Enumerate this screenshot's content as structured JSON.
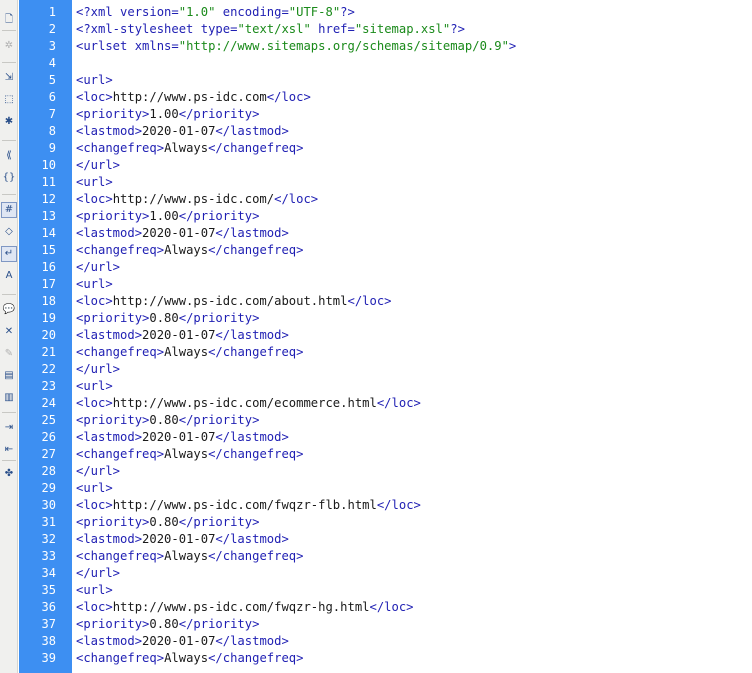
{
  "toolbar": {
    "icons": [
      {
        "name": "open-documents-icon",
        "glyph": "🗋",
        "disabled": false,
        "pressed": false
      },
      {
        "name": "show-code-navigator-icon",
        "glyph": "✲",
        "disabled": true,
        "pressed": false
      },
      {
        "name": "collapse-full-tag-icon",
        "glyph": "⇲",
        "disabled": false,
        "pressed": false
      },
      {
        "name": "collapse-selection-icon",
        "glyph": "⬚",
        "disabled": false,
        "pressed": false
      },
      {
        "name": "expand-all-icon",
        "glyph": "✱",
        "disabled": false,
        "pressed": false
      },
      {
        "name": "select-parent-tag-icon",
        "glyph": "⟪",
        "disabled": false,
        "pressed": false
      },
      {
        "name": "balance-braces-icon",
        "glyph": "{}",
        "disabled": false,
        "pressed": false
      },
      {
        "name": "line-numbers-icon",
        "glyph": "#",
        "disabled": false,
        "pressed": true
      },
      {
        "name": "highlight-invalid-code-icon",
        "glyph": "◇",
        "disabled": false,
        "pressed": false
      },
      {
        "name": "word-wrap-icon",
        "glyph": "↵",
        "disabled": false,
        "pressed": true
      },
      {
        "name": "syntax-coloring-icon",
        "glyph": "A",
        "disabled": false,
        "pressed": false
      },
      {
        "name": "apply-comment-icon",
        "glyph": "💬",
        "disabled": false,
        "pressed": false
      },
      {
        "name": "remove-comment-icon",
        "glyph": "✕",
        "disabled": false,
        "pressed": false
      },
      {
        "name": "wrap-tag-icon",
        "glyph": "✎",
        "disabled": true,
        "pressed": false
      },
      {
        "name": "recent-snippets-icon",
        "glyph": "▤",
        "disabled": false,
        "pressed": false
      },
      {
        "name": "move-css-icon",
        "glyph": "▥",
        "disabled": false,
        "pressed": false
      },
      {
        "name": "indent-code-icon",
        "glyph": "⇥",
        "disabled": false,
        "pressed": false
      },
      {
        "name": "outdent-code-icon",
        "glyph": "⇤",
        "disabled": false,
        "pressed": false
      },
      {
        "name": "format-source-code-icon",
        "glyph": "✤",
        "disabled": false,
        "pressed": false
      }
    ]
  },
  "colors": {
    "gutter": "#3d8ff2",
    "tag": "#1f1fb3",
    "string": "#1a8a1a",
    "text": "#1a1a1a"
  },
  "lines": [
    {
      "n": "1",
      "tokens": [
        [
          "tag",
          "<?xml version="
        ],
        [
          "str",
          "\"1.0\""
        ],
        [
          "tag",
          " encoding="
        ],
        [
          "str",
          "\"UTF-8\""
        ],
        [
          "tag",
          "?>"
        ]
      ]
    },
    {
      "n": "2",
      "tokens": [
        [
          "tag",
          "<?xml-stylesheet type="
        ],
        [
          "str",
          "\"text/xsl\""
        ],
        [
          "tag",
          " href="
        ],
        [
          "str",
          "\"sitemap.xsl\""
        ],
        [
          "tag",
          "?>"
        ]
      ]
    },
    {
      "n": "3",
      "tokens": [
        [
          "tag",
          "<urlset xmlns="
        ],
        [
          "str",
          "\"http://www.sitemaps.org/schemas/sitemap/0.9\""
        ],
        [
          "tag",
          ">"
        ]
      ]
    },
    {
      "n": "4",
      "tokens": []
    },
    {
      "n": "5",
      "tokens": [
        [
          "tag",
          "<url>"
        ]
      ]
    },
    {
      "n": "6",
      "tokens": [
        [
          "tag",
          "<loc>"
        ],
        [
          "txt",
          "http://www.ps-idc.com"
        ],
        [
          "tag",
          "</loc>"
        ]
      ]
    },
    {
      "n": "7",
      "tokens": [
        [
          "tag",
          "<priority>"
        ],
        [
          "txt",
          "1.00"
        ],
        [
          "tag",
          "</priority>"
        ]
      ]
    },
    {
      "n": "8",
      "tokens": [
        [
          "tag",
          "<lastmod>"
        ],
        [
          "txt",
          "2020-01-07"
        ],
        [
          "tag",
          "</lastmod>"
        ]
      ]
    },
    {
      "n": "9",
      "tokens": [
        [
          "tag",
          "<changefreq>"
        ],
        [
          "txt",
          "Always"
        ],
        [
          "tag",
          "</changefreq>"
        ]
      ]
    },
    {
      "n": "10",
      "tokens": [
        [
          "tag",
          "</url>"
        ]
      ]
    },
    {
      "n": "11",
      "tokens": [
        [
          "tag",
          "<url>"
        ]
      ]
    },
    {
      "n": "12",
      "tokens": [
        [
          "tag",
          "<loc>"
        ],
        [
          "txt",
          "http://www.ps-idc.com/"
        ],
        [
          "tag",
          "</loc>"
        ]
      ]
    },
    {
      "n": "13",
      "tokens": [
        [
          "tag",
          "<priority>"
        ],
        [
          "txt",
          "1.00"
        ],
        [
          "tag",
          "</priority>"
        ]
      ]
    },
    {
      "n": "14",
      "tokens": [
        [
          "tag",
          "<lastmod>"
        ],
        [
          "txt",
          "2020-01-07"
        ],
        [
          "tag",
          "</lastmod>"
        ]
      ]
    },
    {
      "n": "15",
      "tokens": [
        [
          "tag",
          "<changefreq>"
        ],
        [
          "txt",
          "Always"
        ],
        [
          "tag",
          "</changefreq>"
        ]
      ]
    },
    {
      "n": "16",
      "tokens": [
        [
          "tag",
          "</url>"
        ]
      ]
    },
    {
      "n": "17",
      "tokens": [
        [
          "tag",
          "<url>"
        ]
      ]
    },
    {
      "n": "18",
      "tokens": [
        [
          "tag",
          "<loc>"
        ],
        [
          "txt",
          "http://www.ps-idc.com/about.html"
        ],
        [
          "tag",
          "</loc>"
        ]
      ]
    },
    {
      "n": "19",
      "tokens": [
        [
          "tag",
          "<priority>"
        ],
        [
          "txt",
          "0.80"
        ],
        [
          "tag",
          "</priority>"
        ]
      ]
    },
    {
      "n": "20",
      "tokens": [
        [
          "tag",
          "<lastmod>"
        ],
        [
          "txt",
          "2020-01-07"
        ],
        [
          "tag",
          "</lastmod>"
        ]
      ]
    },
    {
      "n": "21",
      "tokens": [
        [
          "tag",
          "<changefreq>"
        ],
        [
          "txt",
          "Always"
        ],
        [
          "tag",
          "</changefreq>"
        ]
      ]
    },
    {
      "n": "22",
      "tokens": [
        [
          "tag",
          "</url>"
        ]
      ]
    },
    {
      "n": "23",
      "tokens": [
        [
          "tag",
          "<url>"
        ]
      ]
    },
    {
      "n": "24",
      "tokens": [
        [
          "tag",
          "<loc>"
        ],
        [
          "txt",
          "http://www.ps-idc.com/ecommerce.html"
        ],
        [
          "tag",
          "</loc>"
        ]
      ]
    },
    {
      "n": "25",
      "tokens": [
        [
          "tag",
          "<priority>"
        ],
        [
          "txt",
          "0.80"
        ],
        [
          "tag",
          "</priority>"
        ]
      ]
    },
    {
      "n": "26",
      "tokens": [
        [
          "tag",
          "<lastmod>"
        ],
        [
          "txt",
          "2020-01-07"
        ],
        [
          "tag",
          "</lastmod>"
        ]
      ]
    },
    {
      "n": "27",
      "tokens": [
        [
          "tag",
          "<changefreq>"
        ],
        [
          "txt",
          "Always"
        ],
        [
          "tag",
          "</changefreq>"
        ]
      ]
    },
    {
      "n": "28",
      "tokens": [
        [
          "tag",
          "</url>"
        ]
      ]
    },
    {
      "n": "29",
      "tokens": [
        [
          "tag",
          "<url>"
        ]
      ]
    },
    {
      "n": "30",
      "tokens": [
        [
          "tag",
          "<loc>"
        ],
        [
          "txt",
          "http://www.ps-idc.com/fwqzr-flb.html"
        ],
        [
          "tag",
          "</loc>"
        ]
      ]
    },
    {
      "n": "31",
      "tokens": [
        [
          "tag",
          "<priority>"
        ],
        [
          "txt",
          "0.80"
        ],
        [
          "tag",
          "</priority>"
        ]
      ]
    },
    {
      "n": "32",
      "tokens": [
        [
          "tag",
          "<lastmod>"
        ],
        [
          "txt",
          "2020-01-07"
        ],
        [
          "tag",
          "</lastmod>"
        ]
      ]
    },
    {
      "n": "33",
      "tokens": [
        [
          "tag",
          "<changefreq>"
        ],
        [
          "txt",
          "Always"
        ],
        [
          "tag",
          "</changefreq>"
        ]
      ]
    },
    {
      "n": "34",
      "tokens": [
        [
          "tag",
          "</url>"
        ]
      ]
    },
    {
      "n": "35",
      "tokens": [
        [
          "tag",
          "<url>"
        ]
      ]
    },
    {
      "n": "36",
      "tokens": [
        [
          "tag",
          "<loc>"
        ],
        [
          "txt",
          "http://www.ps-idc.com/fwqzr-hg.html"
        ],
        [
          "tag",
          "</loc>"
        ]
      ]
    },
    {
      "n": "37",
      "tokens": [
        [
          "tag",
          "<priority>"
        ],
        [
          "txt",
          "0.80"
        ],
        [
          "tag",
          "</priority>"
        ]
      ]
    },
    {
      "n": "38",
      "tokens": [
        [
          "tag",
          "<lastmod>"
        ],
        [
          "txt",
          "2020-01-07"
        ],
        [
          "tag",
          "</lastmod>"
        ]
      ]
    },
    {
      "n": "39",
      "tokens": [
        [
          "tag",
          "<changefreq>"
        ],
        [
          "txt",
          "Always"
        ],
        [
          "tag",
          "</changefreq>"
        ]
      ]
    }
  ]
}
